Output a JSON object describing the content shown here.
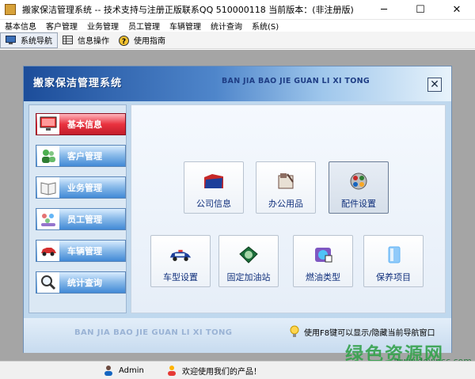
{
  "window": {
    "title": "搬家保洁管理系统 -- 技术支持与注册正版联系QQ 510000118     当前版本：(非注册版)",
    "controls": [
      "─",
      "☐",
      "✕"
    ]
  },
  "menu": [
    "基本信息",
    "客户管理",
    "业务管理",
    "员工管理",
    "车辆管理",
    "统计查询",
    "系统(S)"
  ],
  "toolbar": [
    {
      "label": "系统导航",
      "icon": "monitor-icon"
    },
    {
      "label": "信息操作",
      "icon": "grid-icon"
    },
    {
      "label": "使用指南",
      "icon": "help-icon"
    }
  ],
  "panel": {
    "title": "搬家保洁管理系统",
    "pinyin": "BAN JIA BAO JIE GUAN LI XI TONG",
    "close_label": "✕"
  },
  "nav": [
    {
      "label": "基本信息",
      "icon": "monitor-icon",
      "active": true
    },
    {
      "label": "客户管理",
      "icon": "users-icon",
      "active": false
    },
    {
      "label": "业务管理",
      "icon": "book-icon",
      "active": false
    },
    {
      "label": "员工管理",
      "icon": "staff-icon",
      "active": false
    },
    {
      "label": "车辆管理",
      "icon": "car-icon",
      "active": false
    },
    {
      "label": "统计查询",
      "icon": "magnifier-icon",
      "active": false
    }
  ],
  "tiles": [
    {
      "label": "公司信息",
      "icon": "folder-icon"
    },
    {
      "label": "办公用品",
      "icon": "office-supplies-icon"
    },
    {
      "label": "配件设置",
      "icon": "parts-icon"
    },
    {
      "label": "车型设置",
      "icon": "police-car-icon"
    },
    {
      "label": "固定加油站",
      "icon": "gas-station-icon"
    },
    {
      "label": "燃油类型",
      "icon": "fuel-type-icon"
    },
    {
      "label": "保养项目",
      "icon": "maintenance-icon"
    }
  ],
  "footer": {
    "pinyin": "BAN JIA BAO JIE GUAN LI XI TONG",
    "hint": "使用F8键可以显示/隐藏当前导航窗口"
  },
  "watermark": {
    "main": "绿色资源网",
    "url": "www.downcc.com"
  },
  "status": {
    "user": "Admin",
    "message": "欢迎使用我们的产品！"
  },
  "colors": {
    "nav_active": "#d42a36",
    "nav_normal": "#4189d6",
    "header_blue": "#1c4d9a",
    "tile_label": "#10307c"
  }
}
